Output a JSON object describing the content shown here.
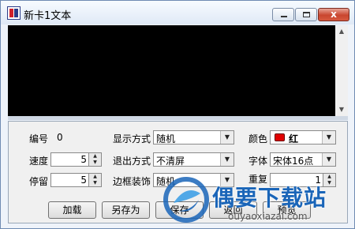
{
  "window": {
    "title": "新卡1文本",
    "close_glyph": "x"
  },
  "fields": {
    "number_label": "编号",
    "number_value": "0",
    "speed_label": "速度",
    "speed_value": "5",
    "stay_label": "停留",
    "stay_value": "5",
    "display_mode_label": "显示方式",
    "display_mode_value": "随机",
    "exit_mode_label": "退出方式",
    "exit_mode_value": "不清屏",
    "border_label": "边框装饰",
    "border_value": "随机",
    "color_label": "颜色",
    "color_value": "红",
    "font_label": "字体",
    "font_value": "宋体16点",
    "repeat_label": "重复",
    "repeat_value": "1"
  },
  "buttons": {
    "load": "加载",
    "save_as": "另存为",
    "save": "保存",
    "back": "返回",
    "preview": "预览"
  },
  "watermark": {
    "brand": "偶要下载站",
    "url": "ouyaoxiazai.com"
  },
  "colors": {
    "swatch": "#e00000",
    "brand": "#1a65b8"
  }
}
